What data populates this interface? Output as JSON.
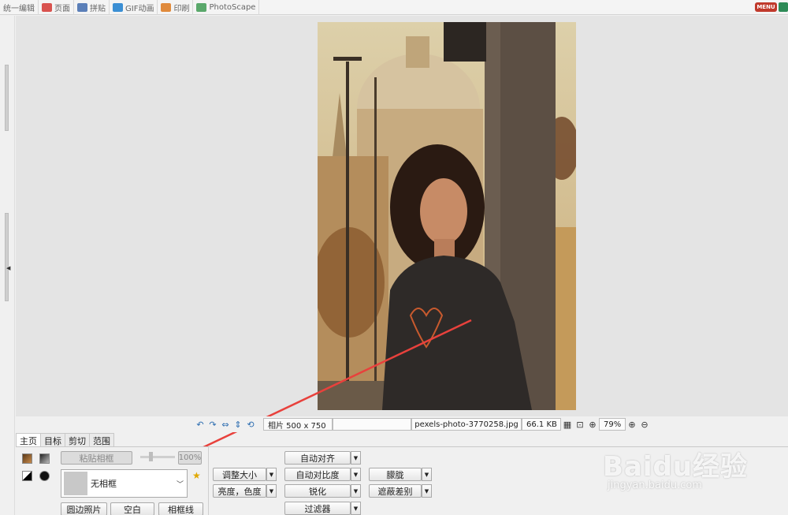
{
  "toolbar": {
    "tabs": [
      {
        "label": "统一编辑",
        "color": "#9aa0a6"
      },
      {
        "label": "页面",
        "color": "#d9534f"
      },
      {
        "label": "拼贴",
        "color": "#5b7fb8"
      },
      {
        "label": "GIF动画",
        "color": "#3b8fd4"
      },
      {
        "label": "印刷",
        "color": "#e08a3c"
      },
      {
        "label": "PhotoScape",
        "color": "#5aa86b"
      }
    ],
    "menu_label": "MENU"
  },
  "status": {
    "photo_size": "相片 500 x 750",
    "filename": "pexels-photo-3770258.jpg",
    "filesize": "66.1 KB",
    "zoom": "79%"
  },
  "tabs": [
    {
      "label": "主页",
      "active": true
    },
    {
      "label": "目标",
      "active": false
    },
    {
      "label": "剪切",
      "active": false
    },
    {
      "label": "范围",
      "active": false
    }
  ],
  "panel": {
    "paste_frame": "粘贴相框",
    "opacity": "100%",
    "frame_name": "无相框",
    "round_photo": "圆边照片",
    "blank": "空白",
    "frame_line": "相框线",
    "resize": "调整大小",
    "brightness": "亮度，色度",
    "auto_level": "自动对齐",
    "auto_contrast": "自动对比度",
    "sharpen": "锐化",
    "filter": "过滤器",
    "bloom": "朦胧",
    "backlight": "遮蔽差别"
  },
  "watermark": {
    "brand": "Baidu经验",
    "url": "jingyan.baidu.com"
  }
}
